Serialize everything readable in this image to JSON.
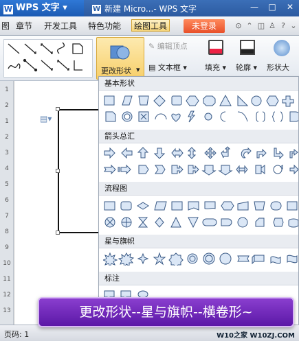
{
  "titlebar": {
    "app_name": "WPS 文字",
    "doc_tab": "新建 Micro...- WPS 文字",
    "min": "—",
    "max": "□",
    "close": "✕"
  },
  "menu": {
    "items": [
      "图",
      "章节",
      "开发工具",
      "特色功能",
      "绘图工具"
    ],
    "login": "未登录"
  },
  "ribbon": {
    "change_shape": "更改形状",
    "edit_points": "编辑顶点",
    "text_box": "文本框",
    "fill": "填充",
    "outline": "轮廓",
    "shape_effect": "形状大"
  },
  "ruler": {
    "marks": [
      "1",
      "2",
      "1",
      "2",
      "3",
      "4",
      "5",
      "6",
      "7",
      "8",
      "9",
      "10",
      "11",
      "12",
      "13"
    ]
  },
  "dropdown": {
    "categories": {
      "basic": "基本形状",
      "arrows": "箭头总汇",
      "flowchart": "流程图",
      "stars": "星与旗帜",
      "callouts": "标注"
    }
  },
  "caption": "更改形状--星与旗帜--横卷形~",
  "status": {
    "page": "页码: 1"
  },
  "watermark": "W10之家 W10ZJ.COM",
  "colors": {
    "accent": "#2c5aa0",
    "caption_bg": "#6a24b5",
    "highlight": "#f7cf6a"
  }
}
